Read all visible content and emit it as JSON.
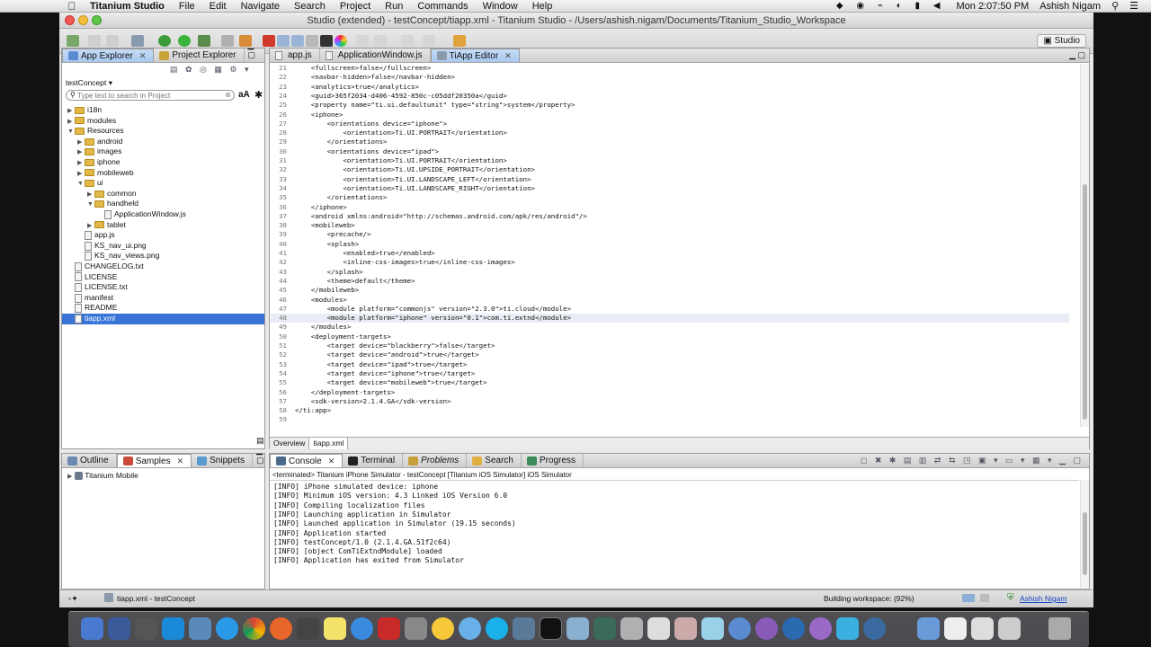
{
  "menubar": {
    "apple": "",
    "items": [
      "Titanium Studio",
      "File",
      "Edit",
      "Navigate",
      "Search",
      "Project",
      "Run",
      "Commands",
      "Window",
      "Help"
    ],
    "clock": "Mon 2:07:50 PM",
    "user": "Ashish Nigam"
  },
  "window": {
    "title": "Studio (extended) - testConcept/tiapp.xml - Titanium Studio - /Users/ashish.nigam/Documents/Titanium_Studio_Workspace",
    "perspective": "Studio"
  },
  "explorer": {
    "tabs": [
      "App Explorer",
      "Project Explorer"
    ],
    "project": "testConcept ▾",
    "search_placeholder": "Type text to search in Project",
    "font_toggle": "aA",
    "tree": [
      {
        "label": "i18n",
        "indent": 0,
        "kind": "folder",
        "tri": "▶"
      },
      {
        "label": "modules",
        "indent": 0,
        "kind": "folder",
        "tri": "▶"
      },
      {
        "label": "Resources",
        "indent": 0,
        "kind": "folder",
        "tri": "▼"
      },
      {
        "label": "android",
        "indent": 1,
        "kind": "folder",
        "tri": "▶"
      },
      {
        "label": "images",
        "indent": 1,
        "kind": "folder",
        "tri": "▶"
      },
      {
        "label": "iphone",
        "indent": 1,
        "kind": "folder",
        "tri": "▶"
      },
      {
        "label": "mobileweb",
        "indent": 1,
        "kind": "folder",
        "tri": "▶"
      },
      {
        "label": "ui",
        "indent": 1,
        "kind": "folder",
        "tri": "▼"
      },
      {
        "label": "common",
        "indent": 2,
        "kind": "folder",
        "tri": "▶"
      },
      {
        "label": "handheld",
        "indent": 2,
        "kind": "folder",
        "tri": "▼"
      },
      {
        "label": "ApplicationWindow.js",
        "indent": 3,
        "kind": "file",
        "tri": ""
      },
      {
        "label": "tablet",
        "indent": 2,
        "kind": "folder",
        "tri": "▶"
      },
      {
        "label": "app.js",
        "indent": 1,
        "kind": "file",
        "tri": ""
      },
      {
        "label": "KS_nav_ui.png",
        "indent": 1,
        "kind": "file",
        "tri": ""
      },
      {
        "label": "KS_nav_views.png",
        "indent": 1,
        "kind": "file",
        "tri": ""
      },
      {
        "label": "CHANGELOG.txt",
        "indent": 0,
        "kind": "file",
        "tri": ""
      },
      {
        "label": "LICENSE",
        "indent": 0,
        "kind": "file",
        "tri": ""
      },
      {
        "label": "LICENSE.txt",
        "indent": 0,
        "kind": "file",
        "tri": ""
      },
      {
        "label": "manifest",
        "indent": 0,
        "kind": "file",
        "tri": ""
      },
      {
        "label": "README",
        "indent": 0,
        "kind": "file",
        "tri": ""
      },
      {
        "label": "tiapp.xml",
        "indent": 0,
        "kind": "file",
        "tri": "",
        "selected": true
      }
    ]
  },
  "outline": {
    "tabs": [
      "Outline",
      "Samples",
      "Snippets"
    ],
    "items": [
      "Titanium Mobile"
    ]
  },
  "editor": {
    "tabs": [
      "app.js",
      "ApplicationWindow.js",
      "TiApp Editor"
    ],
    "bottom_tabs": [
      "Overview",
      "tiapp.xml"
    ],
    "highlight_line": 48,
    "lines": [
      {
        "n": "21",
        "t": "    <fullscreen>false</fullscreen>"
      },
      {
        "n": "22",
        "t": "    <navbar-hidden>false</navbar-hidden>"
      },
      {
        "n": "23",
        "t": "    <analytics>true</analytics>"
      },
      {
        "n": "24",
        "t": "    <guid>365f2034-d406-4592-850c-c05ddf20350a</guid>"
      },
      {
        "n": "25",
        "t": "    <property name=\"ti.ui.defaultunit\" type=\"string\">system</property>"
      },
      {
        "n": "26",
        "t": "    <iphone>"
      },
      {
        "n": "27",
        "t": "        <orientations device=\"iphone\">"
      },
      {
        "n": "28",
        "t": "            <orientation>Ti.UI.PORTRAIT</orientation>"
      },
      {
        "n": "29",
        "t": "        </orientations>"
      },
      {
        "n": "30",
        "t": "        <orientations device=\"ipad\">"
      },
      {
        "n": "31",
        "t": "            <orientation>Ti.UI.PORTRAIT</orientation>"
      },
      {
        "n": "32",
        "t": "            <orientation>Ti.UI.UPSIDE_PORTRAIT</orientation>"
      },
      {
        "n": "33",
        "t": "            <orientation>Ti.UI.LANDSCAPE_LEFT</orientation>"
      },
      {
        "n": "34",
        "t": "            <orientation>Ti.UI.LANDSCAPE_RIGHT</orientation>"
      },
      {
        "n": "35",
        "t": "        </orientations>"
      },
      {
        "n": "36",
        "t": "    </iphone>"
      },
      {
        "n": "37",
        "t": "    <android xmlns:android=\"http://schemas.android.com/apk/res/android\"/>"
      },
      {
        "n": "38",
        "t": "    <mobileweb>"
      },
      {
        "n": "39",
        "t": "        <precache/>"
      },
      {
        "n": "40",
        "t": "        <splash>"
      },
      {
        "n": "41",
        "t": "            <enabled>true</enabled>"
      },
      {
        "n": "42",
        "t": "            <inline-css-images>true</inline-css-images>"
      },
      {
        "n": "43",
        "t": "        </splash>"
      },
      {
        "n": "44",
        "t": "        <theme>default</theme>"
      },
      {
        "n": "45",
        "t": "    </mobileweb>"
      },
      {
        "n": "46",
        "t": "    <modules>"
      },
      {
        "n": "47",
        "t": "        <module platform=\"commonjs\" version=\"2.3.0\">ti.cloud</module>"
      },
      {
        "n": "48",
        "t": "        <module platform=\"iphone\" version=\"0.1\">com.ti.extnd</module>"
      },
      {
        "n": "49",
        "t": "    </modules>"
      },
      {
        "n": "50",
        "t": "    <deployment-targets>"
      },
      {
        "n": "51",
        "t": "        <target device=\"blackberry\">false</target>"
      },
      {
        "n": "52",
        "t": "        <target device=\"android\">true</target>"
      },
      {
        "n": "53",
        "t": "        <target device=\"ipad\">true</target>"
      },
      {
        "n": "54",
        "t": "        <target device=\"iphone\">true</target>"
      },
      {
        "n": "55",
        "t": "        <target device=\"mobileweb\">true</target>"
      },
      {
        "n": "56",
        "t": "    </deployment-targets>"
      },
      {
        "n": "57",
        "t": "    <sdk-version>2.1.4.GA</sdk-version>"
      },
      {
        "n": "58",
        "t": "</ti:app>"
      },
      {
        "n": "59",
        "t": ""
      }
    ]
  },
  "console": {
    "tabs": [
      "Console",
      "Terminal",
      "Problems",
      "Search",
      "Progress"
    ],
    "header": "<terminated> Titanium iPhone Simulator - testConcept [Titanium iOS Simulator] iOS Simulator",
    "lines": [
      "[INFO] iPhone simulated device: iphone",
      "[INFO] Minimum iOS version: 4.3 Linked iOS Version 6.0",
      "[INFO] Compiling localization files",
      "[INFO] Launching application in Simulator",
      "[INFO] Launched application in Simulator (19.15 seconds)",
      "[INFO] Application started",
      "[INFO] testConcept/1.0 (2.1.4.GA.51f2c64)",
      "[INFO] [object ComTiExtndModule] loaded",
      "[INFO] Application has exited from Simulator"
    ]
  },
  "statusbar": {
    "file": "tiapp.xml - testConcept",
    "progress": "Building workspace: (92%)",
    "user": "Ashish Nigam"
  },
  "colors": {
    "selection": "#3875d7",
    "highlight_line": "#e8ecf4",
    "tag": "#111111"
  }
}
